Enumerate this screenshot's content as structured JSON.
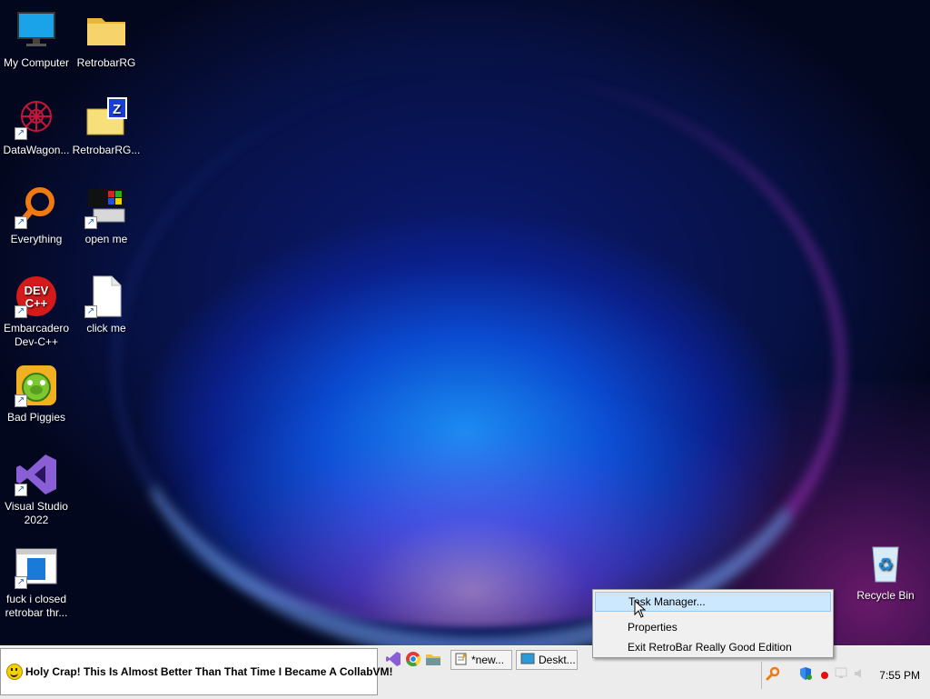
{
  "desktop": {
    "icons": [
      {
        "label": "My Computer"
      },
      {
        "label": "RetrobarRG"
      },
      {
        "label": "DataWagon..."
      },
      {
        "label": "RetrobarRG..."
      },
      {
        "label": "Everything"
      },
      {
        "label": "open me"
      },
      {
        "label": "Embarcadero Dev-C++"
      },
      {
        "label": "click me"
      },
      {
        "label": "Bad Piggies"
      },
      {
        "label": "Visual Studio 2022"
      },
      {
        "label": "fuck i closed retrobar thr..."
      },
      {
        "label": "Recycle Bin"
      }
    ]
  },
  "taskbar": {
    "start_text": "Holy Crap! This Is Almost Better Than That Time I Became A CollabVM!",
    "tasks": [
      {
        "label": "*new..."
      },
      {
        "label": "Deskt..."
      }
    ],
    "clock": "7:55 PM"
  },
  "context_menu": {
    "items": [
      {
        "label": "Task Manager..."
      },
      {
        "label": "Properties"
      },
      {
        "label": "Exit RetroBar Really Good Edition"
      }
    ]
  },
  "colors": {
    "menu_highlight": "#cce8ff",
    "taskbar": "#ececec"
  }
}
